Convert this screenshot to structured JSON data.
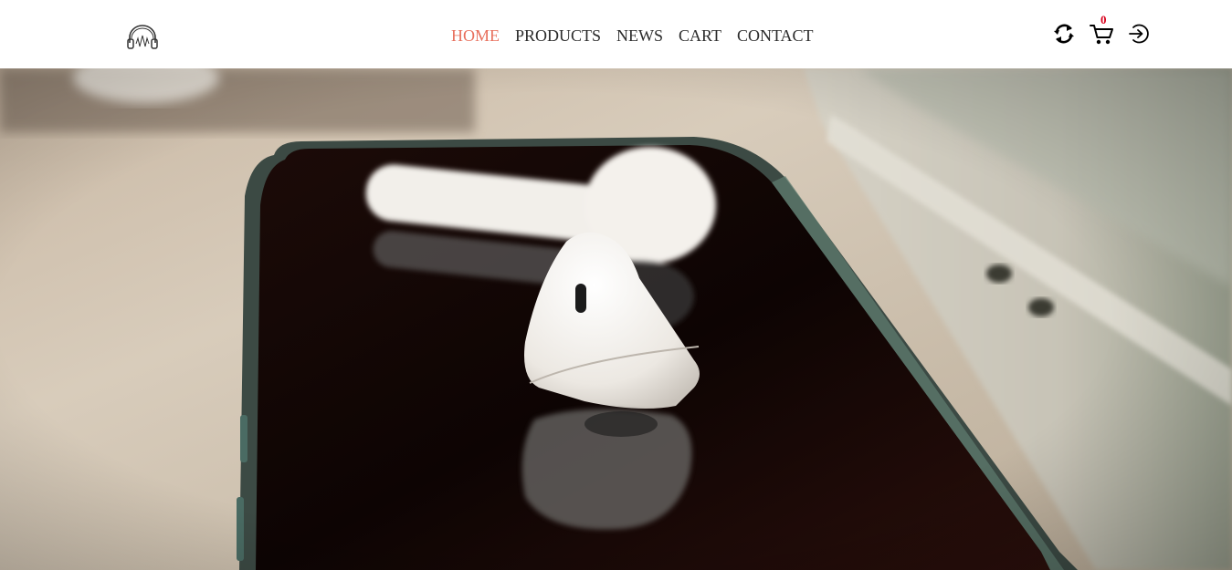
{
  "header": {
    "logo_icon": "headphones-icon",
    "nav": {
      "home": "HOME",
      "products": "PRODUCTS",
      "news": "NEWS",
      "cart": "CART",
      "contact": "CONTACT",
      "active": "home"
    },
    "actions": {
      "refresh_icon": "refresh-icon",
      "cart_icon": "shopping-cart-icon",
      "cart_count": "0",
      "login_icon": "login-icon"
    }
  },
  "hero": {
    "image": "earbuds-on-smartphone-photo"
  },
  "colors": {
    "accent": "#e8705d",
    "nav_text": "#2b2b2b",
    "badge": "#d8001c",
    "header_bg": "#ffffff"
  }
}
